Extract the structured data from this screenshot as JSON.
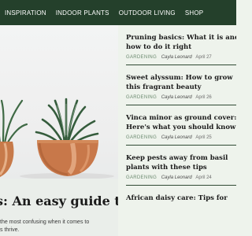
{
  "nav": {
    "items": [
      "INSPIRATION",
      "INDOOR PLANTS",
      "OUTDOOR LIVING",
      "SHOP"
    ]
  },
  "hero": {
    "title": "s: An easy guide to",
    "excerpt": "the most confusing when it comes to\ns thrive."
  },
  "articles": [
    {
      "title": "Pruning basics: What it is and how to do it right",
      "category": "GARDENING",
      "author": "Cayla Leonard",
      "date": "April 27"
    },
    {
      "title": "Sweet alyssum: How to grow this fragrant beauty",
      "category": "GARDENING",
      "author": "Cayla Leonard",
      "date": "April 26"
    },
    {
      "title": "Vinca minor as ground cover: Here's what you should know",
      "category": "GARDENING",
      "author": "Cayla Leonard",
      "date": "April 25"
    },
    {
      "title": "Keep pests away from basil plants with these tips",
      "category": "GARDENING",
      "author": "Cayla Leonard",
      "date": "April 24"
    },
    {
      "title": "African daisy care: Tips for",
      "category": "",
      "author": "",
      "date": ""
    }
  ],
  "colors": {
    "nav_bg": "#24402b",
    "page_bg": "#eef3ec",
    "divider": "#2f4a34",
    "category": "#6b8a6f"
  }
}
